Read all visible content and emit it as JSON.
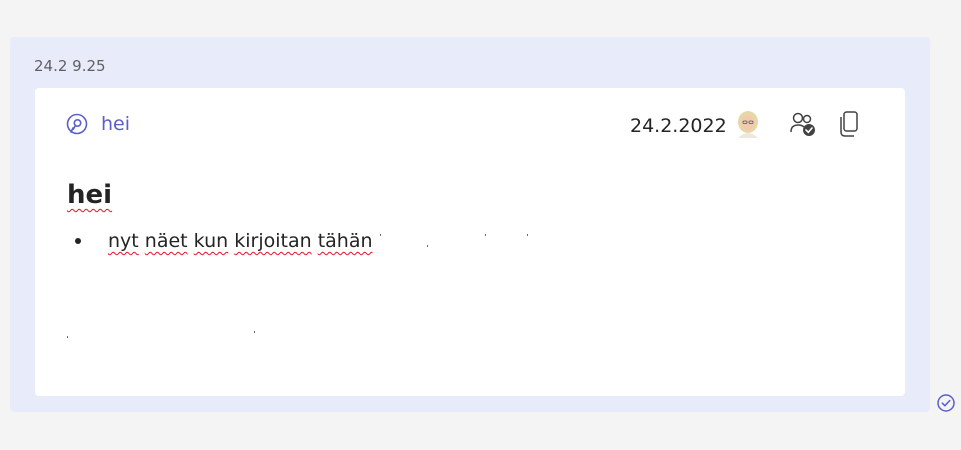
{
  "message": {
    "timestamp": "24.2 9.25",
    "card": {
      "title": "hei",
      "title_icon": "loop-chat-icon",
      "date": "24.2.2022",
      "avatar_icon": "user-avatar",
      "share_icon": "people-checked-icon",
      "copy_icon": "copy-icon",
      "heading": "hei",
      "bullet_words": [
        "nyt",
        "näet",
        "kun",
        "kirjoitan",
        "tähän"
      ]
    },
    "status_icon": "seen-check-icon"
  },
  "colors": {
    "bubble_bg": "#e8ebfa",
    "accent": "#5b5fc7",
    "text": "#242424",
    "spellcheck": "#e81123",
    "page_bg": "#f4f4f4"
  }
}
